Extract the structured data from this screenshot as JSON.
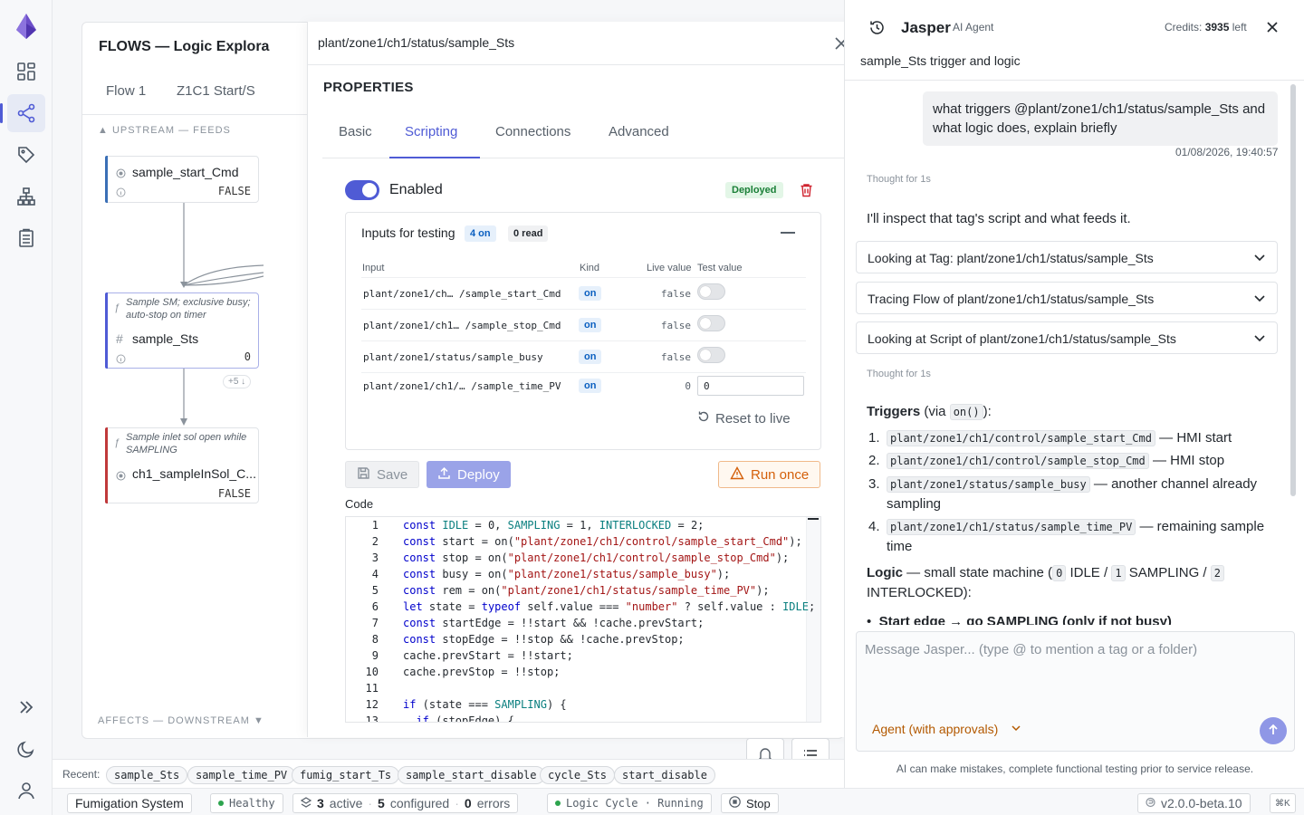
{
  "nav": {
    "items": [
      "logo",
      "dashboard",
      "flows",
      "tags",
      "hierarchy",
      "reports"
    ],
    "bottom": [
      "expand",
      "theme",
      "user"
    ]
  },
  "flow": {
    "title": "FLOWS — Logic Explora",
    "tabs": [
      "Flow 1",
      "Z1C1 Start/S"
    ],
    "upstream_label": "▲ UPSTREAM — FEEDS",
    "downstream_label": "AFFECTS — DOWNSTREAM ▼",
    "nodes": {
      "n1": {
        "name": "sample_start_Cmd",
        "value": "FALSE",
        "color": "#3b6fb6"
      },
      "n2": {
        "desc": "Sample SM; exclusive busy; auto-stop on timer",
        "name": "sample_Sts",
        "value": "0",
        "more": "+5 ↓",
        "color": "#4f5bd5"
      },
      "n3": {
        "desc": "Sample inlet sol open while SAMPLING",
        "name": "ch1_sampleInSol_C...",
        "value": "FALSE",
        "color": "#c0393b"
      }
    }
  },
  "modal": {
    "path": "plant/zone1/ch1/status/sample_Sts",
    "heading": "PROPERTIES",
    "tabs": [
      "Basic",
      "Scripting",
      "Connections",
      "Advanced"
    ],
    "enabled_label": "Enabled",
    "deployed": "Deployed",
    "inputs": {
      "title": "Inputs for testing",
      "on_count": "4 on",
      "read_count": "0 read",
      "headers": {
        "input": "Input",
        "kind": "Kind",
        "live": "Live value",
        "test": "Test value"
      },
      "rows": [
        {
          "input": "plant/zone1/ch… /sample_start_Cmd",
          "kind": "on",
          "live": "false"
        },
        {
          "input": "plant/zone1/ch1… /sample_stop_Cmd",
          "kind": "on",
          "live": "false"
        },
        {
          "input": "plant/zone1/status/sample_busy",
          "kind": "on",
          "live": "false"
        },
        {
          "input": "plant/zone1/ch1/… /sample_time_PV",
          "kind": "on",
          "live": "0",
          "test": "0"
        }
      ],
      "reset_label": "Reset to live"
    },
    "save_label": "Save",
    "deploy_label": "Deploy",
    "run_label": "Run once",
    "code_label": "Code"
  },
  "recent": {
    "label": "Recent:",
    "items": [
      "sample_Sts",
      "sample_time_PV",
      "fumig_start_Ts",
      "sample_start_disable",
      "cycle_Sts",
      "start_disable"
    ]
  },
  "status": {
    "system": "Fumigation System",
    "health": "Healthy",
    "active_n": "3",
    "active": "active",
    "configured_n": "5",
    "configured": "configured",
    "errors_n": "0",
    "errors": "errors",
    "cycle": "Logic Cycle · Running",
    "stop": "Stop",
    "version": "v2.0.0-beta.10",
    "shortcut": "⌘K"
  },
  "agent": {
    "name": "Jasper",
    "role": "AI Agent",
    "credits_prefix": "Credits:",
    "credits": "3935",
    "credits_suffix": "left",
    "conversation": "sample_Sts trigger and logic",
    "user_msg": "what triggers @plant/zone1/ch1/status/sample_Sts and what logic does, explain briefly",
    "timestamp": "01/08/2026, 19:40:57",
    "thought1": "Thought for 1s",
    "reply1": "I'll inspect that tag's script and what feeds it.",
    "steps": [
      "Looking at Tag: plant/zone1/ch1/status/sample_Sts",
      "Tracing Flow of plant/zone1/ch1/status/sample_Sts",
      "Looking at Script of plant/zone1/ch1/status/sample_Sts"
    ],
    "thought2": "Thought for 1s",
    "triggers_title": "Triggers",
    "triggers_via": "(via",
    "triggers_fn": "on()",
    "triggers_close": "):",
    "triggers": [
      {
        "code": "plant/zone1/ch1/control/sample_start_Cmd",
        "text": "— HMI start"
      },
      {
        "code": "plant/zone1/ch1/control/sample_stop_Cmd",
        "text": "— HMI stop"
      },
      {
        "code": "plant/zone1/status/sample_busy",
        "text": "— another channel already sampling"
      },
      {
        "code": "plant/zone1/ch1/status/sample_time_PV",
        "text": "— remaining sample time"
      }
    ],
    "logic_title": "Logic",
    "logic_text": "— small state machine (",
    "logic_s0": "0",
    "logic_l0": "IDLE /",
    "logic_s1": "1",
    "logic_l1": "SAMPLING /",
    "logic_s2": "2",
    "logic_l2": "INTERLOCKED):",
    "bullet": "Start edge → go SAMPLING (only if not busy)",
    "placeholder": "Message Jasper... (type @ to mention a tag or a folder)",
    "mode": "Agent (with approvals)",
    "disclaimer": "AI can make mistakes, complete functional testing prior to service release."
  }
}
